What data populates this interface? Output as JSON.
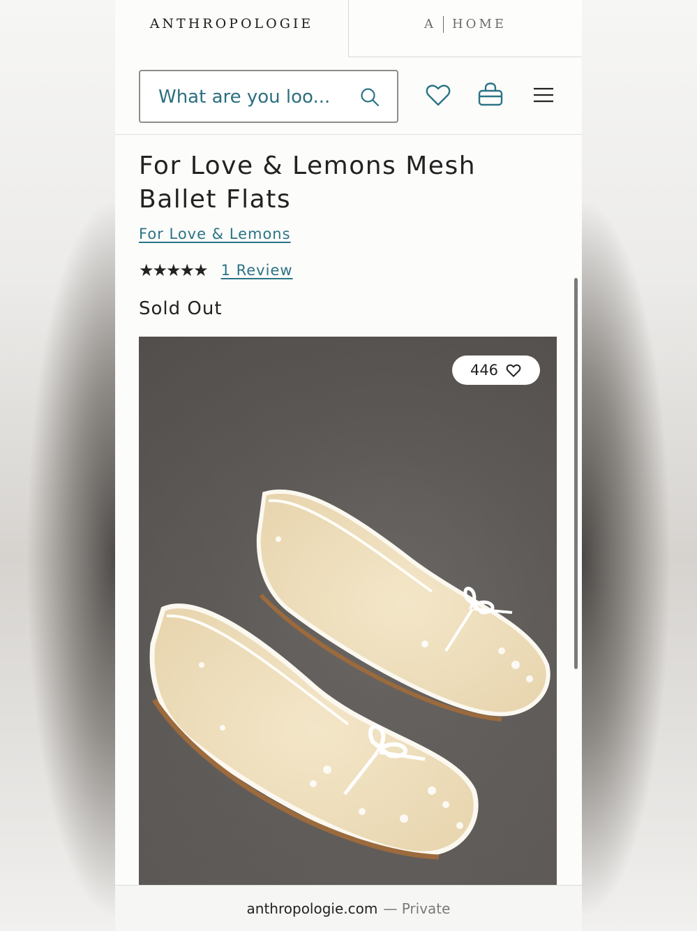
{
  "tabs": {
    "primary": "ANTHROPOLOGIE",
    "secondary_mark": "A",
    "secondary_label": "HOME"
  },
  "search": {
    "placeholder": "What are you loo..."
  },
  "header_icons": [
    "heart-icon",
    "shopping-bag-icon",
    "menu-icon"
  ],
  "product": {
    "title": "For Love & Lemons Mesh Ballet Flats",
    "brand": "For Love & Lemons",
    "rating_stars": "★★★★★",
    "rating_value": 5,
    "reviews_link": "1 Review",
    "status": "Sold Out",
    "favorites_count": "446",
    "image_alt": "Cream mesh ballet flats with white floral embroidery and bows"
  },
  "browser": {
    "domain": "anthropologie.com",
    "mode": "— Private"
  },
  "colors": {
    "link": "#2b7386",
    "text": "#222222",
    "background": "#fcfcfa"
  }
}
